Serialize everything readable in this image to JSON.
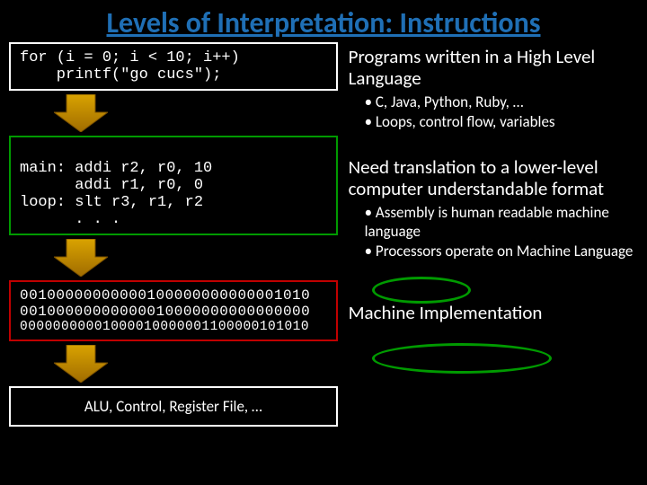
{
  "title": "Levels of Interpretation: Instructions",
  "left": {
    "code1_ln1": "for (i = 0; i < 10; i++)",
    "code1_ln2": "    printf(\"go cucs\");",
    "code2_ln1": "main: addi r2, r0, 10",
    "code2_ln2": "      addi r1, r0, 0",
    "code2_ln3": "loop: slt r3, r1, r2",
    "code2_ln4": "      . . .",
    "code3_ln1": "00100000000000100000000000001010",
    "code3_ln2": "00100000000000010000000000000000",
    "code3_ln3": "00000000001000010000001100000101010",
    "box4": "ALU, Control, Register File, …"
  },
  "right": {
    "p1": "Programs written in a High Level Language",
    "b1a": "C, Java, Python, Ruby, …",
    "b1b": "Loops, control flow, variables",
    "p2": "Need translation to a lower-level computer understandable format",
    "b2a": "Assembly is human readable machine language",
    "b2b": "Processors operate on Machine Language",
    "p3": "Machine Implementation"
  }
}
